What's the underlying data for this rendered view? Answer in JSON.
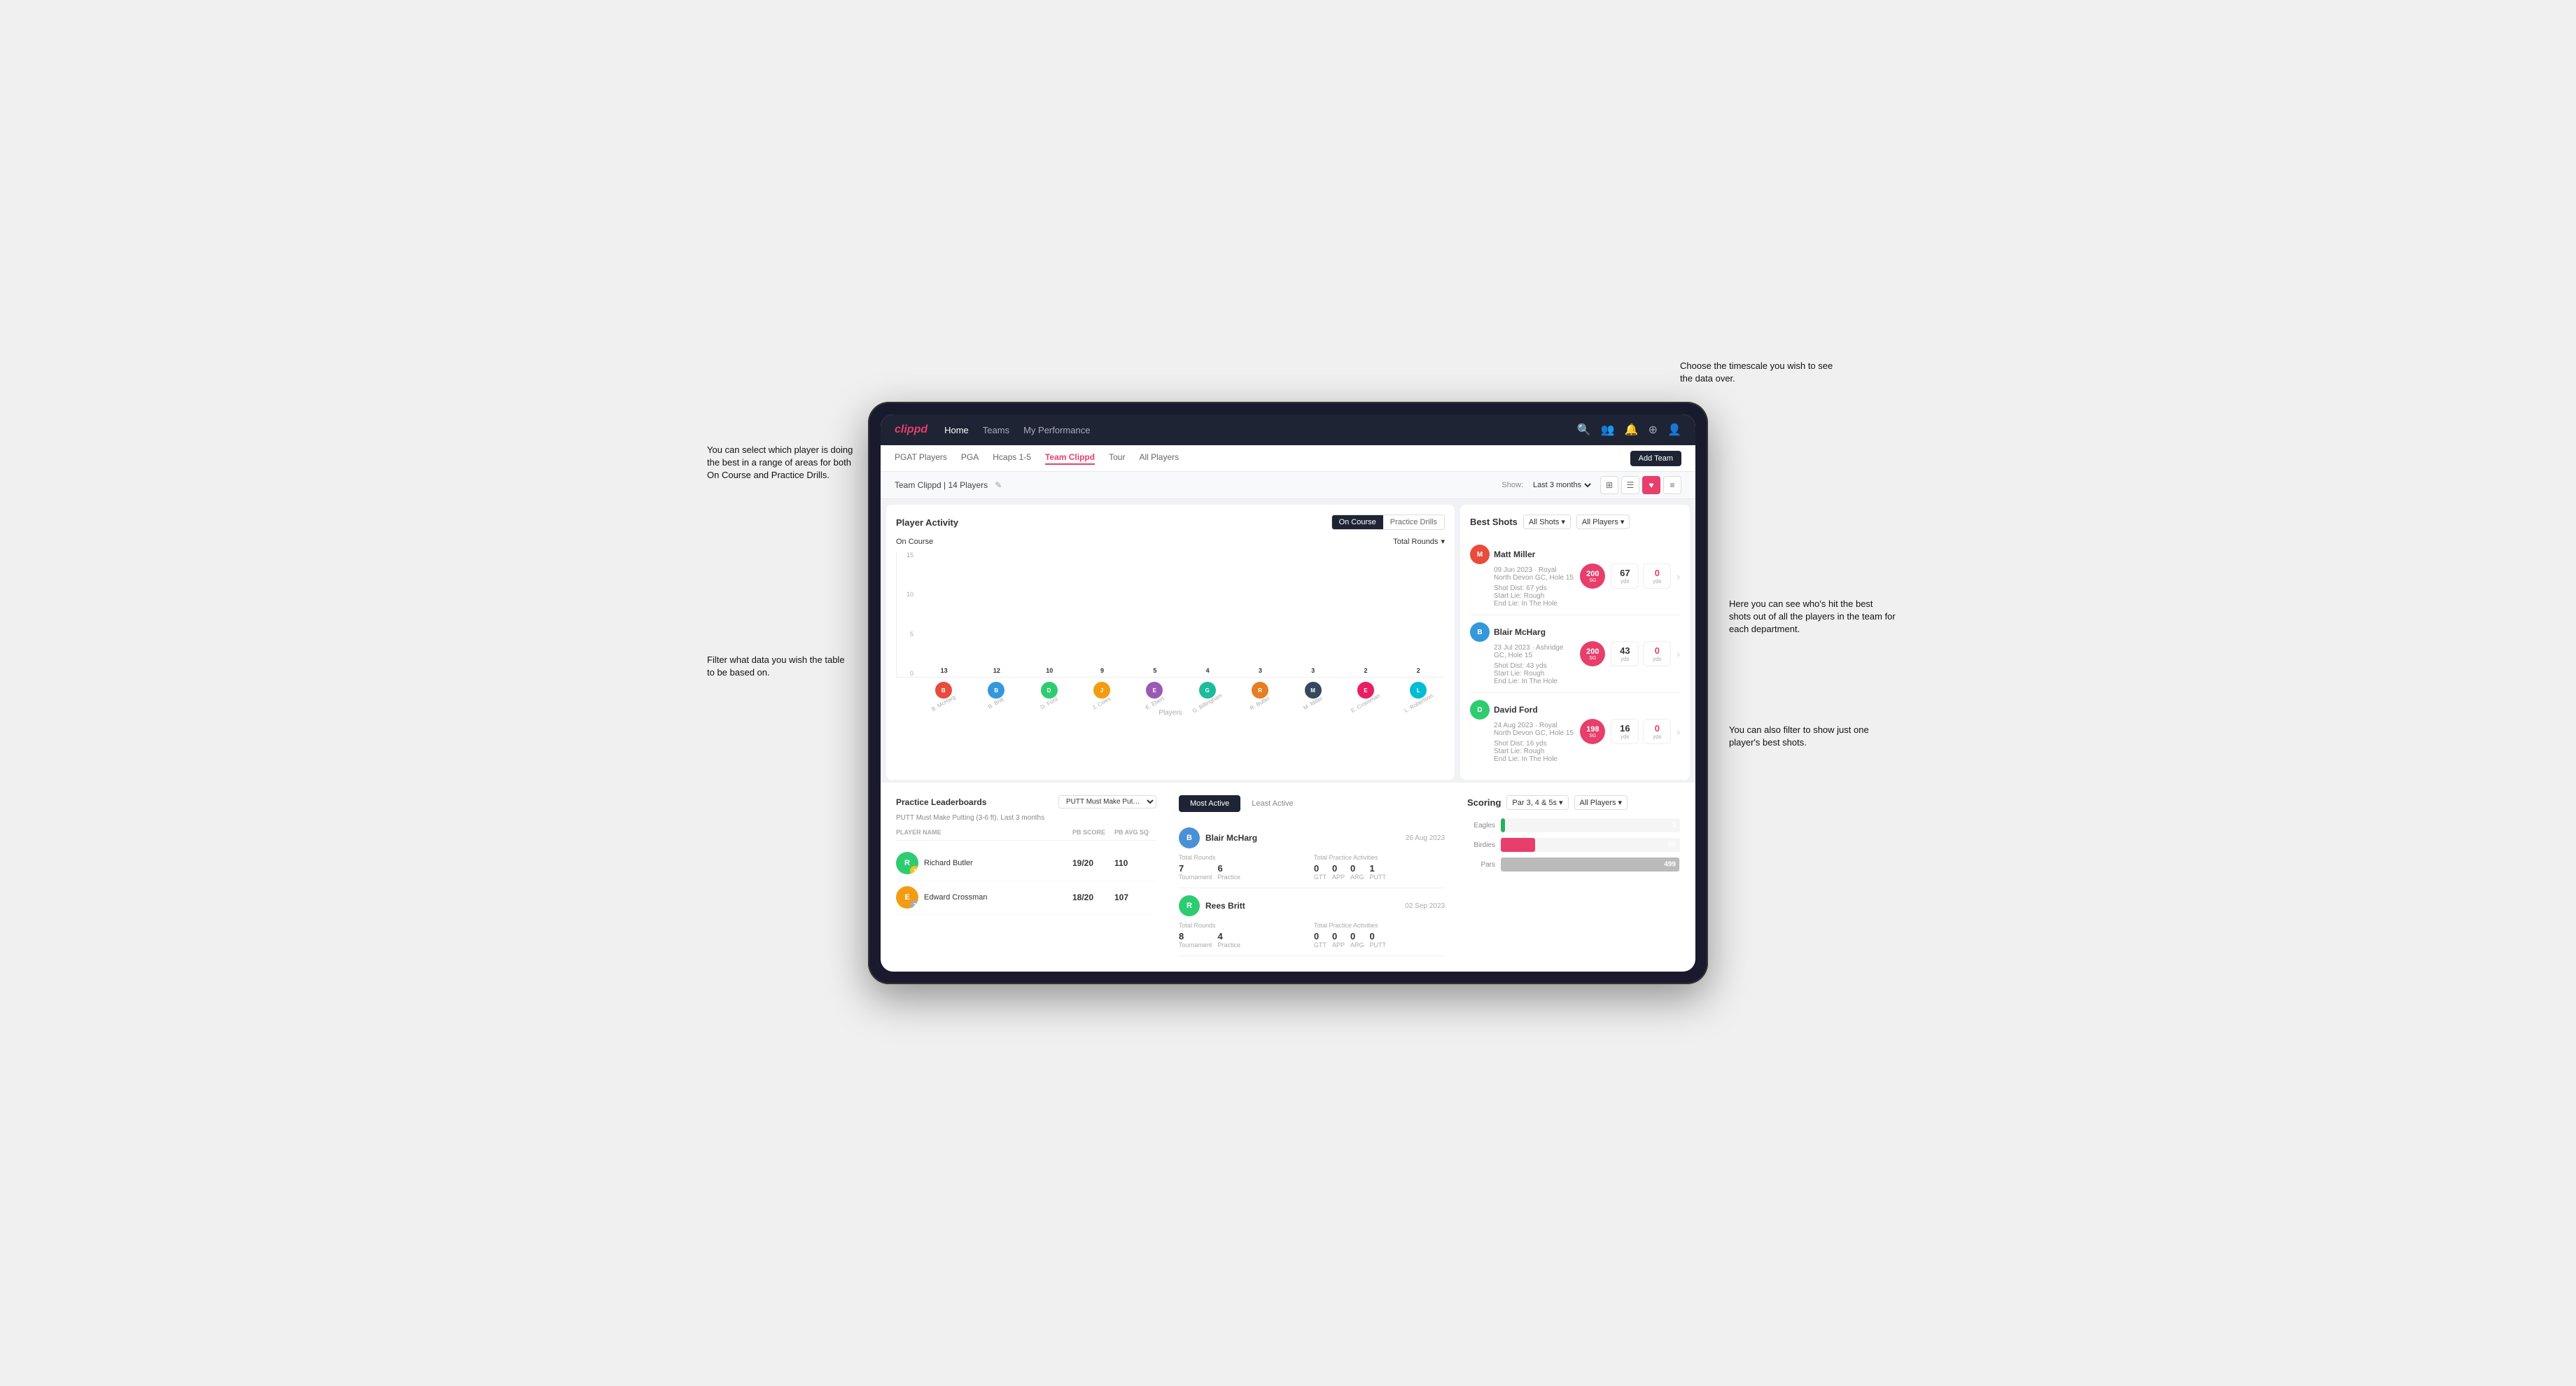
{
  "annotations": {
    "top_right": "Choose the timescale you wish to see the data over.",
    "left_top": "You can select which player is doing the best in a range of areas for both On Course and Practice Drills.",
    "left_bottom": "Filter what data you wish the table to be based on.",
    "right_middle": "Here you can see who's hit the best shots out of all the players in the team for each department.",
    "right_bottom": "You can also filter to show just one player's best shots."
  },
  "nav": {
    "logo": "clippd",
    "links": [
      "Home",
      "Teams",
      "My Performance"
    ],
    "icons": [
      "search",
      "people",
      "bell",
      "add-circle",
      "user"
    ]
  },
  "sub_nav": {
    "tabs": [
      "PGAT Players",
      "PGA",
      "Hcaps 1-5",
      "Team Clippd",
      "Tour",
      "All Players"
    ],
    "active": "Team Clippd",
    "add_team_label": "Add Team"
  },
  "team_header": {
    "name": "Team Clippd | 14 Players",
    "show_label": "Show:",
    "show_value": "Last 3 months"
  },
  "player_activity": {
    "title": "Player Activity",
    "toggle_on_course": "On Course",
    "toggle_practice": "Practice Drills",
    "active_toggle": "On Course",
    "section_title": "On Course",
    "filter_label": "Total Rounds",
    "y_labels": [
      "15",
      "10",
      "5",
      "0"
    ],
    "bars": [
      {
        "name": "B. McHarg",
        "value": 13,
        "highlighted": true
      },
      {
        "name": "B. Britt",
        "value": 12,
        "highlighted": true
      },
      {
        "name": "D. Ford",
        "value": 10,
        "highlighted": false
      },
      {
        "name": "J. Coles",
        "value": 9,
        "highlighted": false
      },
      {
        "name": "E. Ebert",
        "value": 5,
        "highlighted": false
      },
      {
        "name": "G. Billingham",
        "value": 4,
        "highlighted": false
      },
      {
        "name": "R. Butler",
        "value": 3,
        "highlighted": false
      },
      {
        "name": "M. Miller",
        "value": 3,
        "highlighted": false
      },
      {
        "name": "E. Crossman",
        "value": 2,
        "highlighted": false
      },
      {
        "name": "L. Robertson",
        "value": 2,
        "highlighted": false
      }
    ],
    "x_label": "Players"
  },
  "best_shots": {
    "title": "Best Shots",
    "filter1": "All Shots",
    "filter2": "All Players",
    "shots": [
      {
        "player": "Matt Miller",
        "date": "09 Jun 2023",
        "course": "Royal North Devon GC",
        "hole": "Hole 15",
        "badge_value": "200",
        "badge_sub": "SG",
        "badge_color": "red",
        "details": "Shot Dist: 67 yds\nStart Lie: Rough\nEnd Lie: In The Hole",
        "stat1_value": "67",
        "stat1_label": "yds",
        "stat2_value": "0",
        "stat2_label": "yds"
      },
      {
        "player": "Blair McHarg",
        "date": "23 Jul 2023",
        "course": "Ashridge GC",
        "hole": "Hole 15",
        "badge_value": "200",
        "badge_sub": "SG",
        "badge_color": "red",
        "details": "Shot Dist: 43 yds\nStart Lie: Rough\nEnd Lie: In The Hole",
        "stat1_value": "43",
        "stat1_label": "yds",
        "stat2_value": "0",
        "stat2_label": "yds"
      },
      {
        "player": "David Ford",
        "date": "24 Aug 2023",
        "course": "Royal North Devon GC",
        "hole": "Hole 15",
        "badge_value": "198",
        "badge_sub": "SG",
        "badge_color": "red",
        "details": "Shot Dist: 16 yds\nStart Lie: Rough\nEnd Lie: In The Hole",
        "stat1_value": "16",
        "stat1_label": "yds",
        "stat2_value": "0",
        "stat2_label": "yds"
      }
    ]
  },
  "practice_leaderboards": {
    "title": "Practice Leaderboards",
    "drill_select": "PUTT Must Make Putting ...",
    "subtitle": "PUTT Must Make Putting (3-6 ft), Last 3 months",
    "columns": [
      "Player Name",
      "PB Score",
      "PB Avg SQ"
    ],
    "rows": [
      {
        "name": "Richard Butler",
        "rank": "1",
        "rank_color": "gold",
        "pb_score": "19/20",
        "pb_avg": "110"
      },
      {
        "name": "Edward Crossman",
        "rank": "2",
        "rank_color": "silver",
        "pb_score": "18/20",
        "pb_avg": "107"
      }
    ]
  },
  "most_active": {
    "tab_active": "Most Active",
    "tab_inactive": "Least Active",
    "players": [
      {
        "name": "Blair McHarg",
        "avatar_color": "#4a90d9",
        "date": "26 Aug 2023",
        "total_rounds_label": "Total Rounds",
        "tournament": "7",
        "practice": "6",
        "total_practice_label": "Total Practice Activities",
        "gtt": "0",
        "app": "0",
        "arg": "0",
        "putt": "1"
      },
      {
        "name": "Rees Britt",
        "avatar_color": "#2ecc71",
        "date": "02 Sep 2023",
        "total_rounds_label": "Total Rounds",
        "tournament": "8",
        "practice": "4",
        "total_practice_label": "Total Practice Activities",
        "gtt": "0",
        "app": "0",
        "arg": "0",
        "putt": "0"
      }
    ]
  },
  "scoring": {
    "title": "Scoring",
    "filter1": "Par 3, 4 & 5s",
    "filter2": "All Players",
    "rows": [
      {
        "label": "Eagles",
        "value": 3,
        "max": 500,
        "color": "#27ae60"
      },
      {
        "label": "Birdies",
        "value": 96,
        "max": 500,
        "color": "#e83e6c"
      },
      {
        "label": "Pars",
        "value": 499,
        "max": 500,
        "color": "#bbb"
      }
    ]
  },
  "avatar_colors": [
    "#e74c3c",
    "#3498db",
    "#2ecc71",
    "#f39c12",
    "#9b59b6",
    "#1abc9c",
    "#e67e22",
    "#34495e",
    "#e91e63",
    "#00bcd4"
  ]
}
